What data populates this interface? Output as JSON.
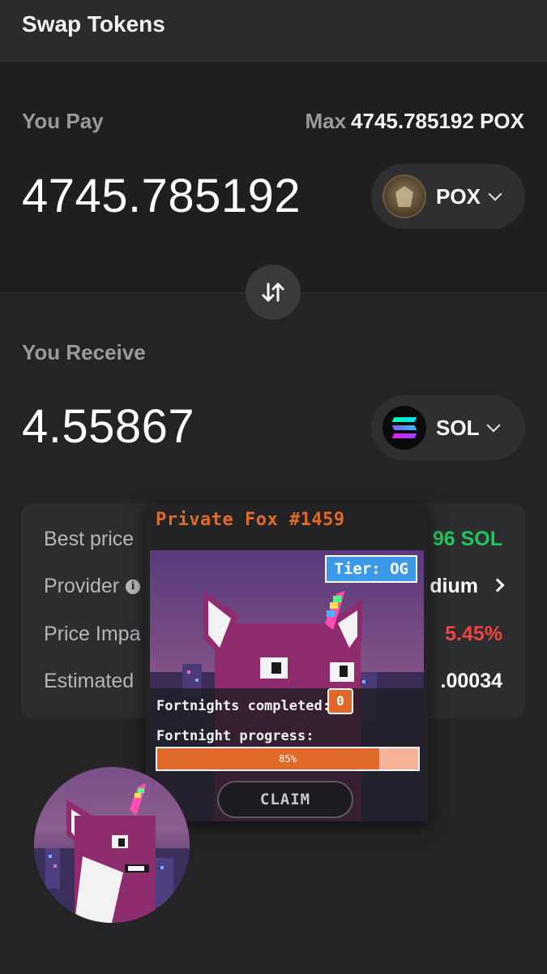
{
  "header": {
    "title": "Swap Tokens"
  },
  "pay": {
    "label": "You Pay",
    "max_label": "Max",
    "max_value": "4745.785192 POX",
    "amount": "4745.785192",
    "token": {
      "symbol": "POX",
      "icon": "pox-token-icon"
    }
  },
  "receive": {
    "label": "You Receive",
    "amount": "4.55867",
    "token": {
      "symbol": "SOL",
      "icon": "solana-token-icon"
    }
  },
  "details": {
    "rows": [
      {
        "label": "Best price",
        "value": "96 SOL",
        "value_color": "#22c55e"
      },
      {
        "label": "Provider",
        "value": "dium",
        "value_color": "#ffffff"
      },
      {
        "label": "Price Impa",
        "value": "5.45%",
        "value_color": "#ef4444"
      },
      {
        "label": "Estimated",
        "value": ".00034",
        "value_color": "#ffffff"
      }
    ]
  },
  "popup": {
    "title": "Private Fox #1459",
    "tier": "Tier: OG",
    "fortnights_label": "Fortnights completed:",
    "fortnights_count": "0",
    "progress_label": "Fortnight progress:",
    "progress_text": "85%",
    "progress_fraction": 0.85,
    "claim_label": "CLAIM"
  },
  "colors": {
    "accent_orange": "#e06a2a",
    "success_green": "#22c55e",
    "danger_red": "#ef4444",
    "tier_blue": "#3a9ae8"
  }
}
